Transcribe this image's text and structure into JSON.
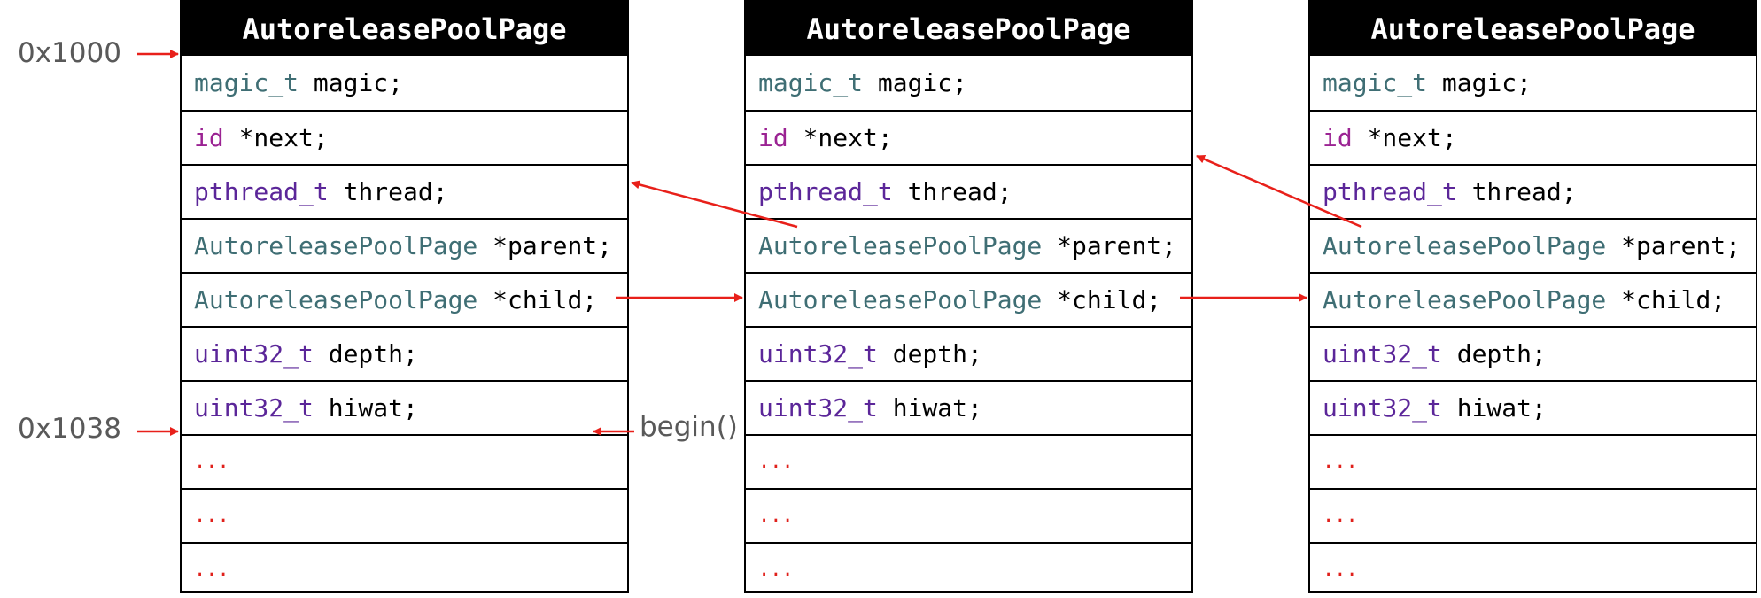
{
  "pages": [
    {
      "title": "AutoreleasePoolPage",
      "rows": [
        [
          {
            "text": "magic_t",
            "style": "teal"
          },
          {
            "text": " magic;",
            "style": "plain"
          }
        ],
        [
          {
            "text": "id",
            "style": "magenta"
          },
          {
            "text": " *next;",
            "style": "plain"
          }
        ],
        [
          {
            "text": "pthread_t",
            "style": "purple"
          },
          {
            "text": " thread;",
            "style": "plain"
          }
        ],
        [
          {
            "text": "AutoreleasePoolPage",
            "style": "teal"
          },
          {
            "text": " *parent;",
            "style": "plain"
          }
        ],
        [
          {
            "text": "AutoreleasePoolPage",
            "style": "teal"
          },
          {
            "text": " *child;",
            "style": "plain"
          }
        ],
        [
          {
            "text": "uint32_t",
            "style": "purple"
          },
          {
            "text": " depth;",
            "style": "plain"
          }
        ],
        [
          {
            "text": "uint32_t",
            "style": "purple"
          },
          {
            "text": " hiwat;",
            "style": "plain"
          }
        ],
        [
          {
            "text": "...",
            "style": "red"
          }
        ],
        [
          {
            "text": "...",
            "style": "red"
          }
        ],
        [
          {
            "text": "...",
            "style": "red"
          }
        ]
      ]
    },
    {
      "title": "AutoreleasePoolPage",
      "rows": [
        [
          {
            "text": "magic_t",
            "style": "teal"
          },
          {
            "text": " magic;",
            "style": "plain"
          }
        ],
        [
          {
            "text": "id",
            "style": "magenta"
          },
          {
            "text": " *next;",
            "style": "plain"
          }
        ],
        [
          {
            "text": "pthread_t",
            "style": "purple"
          },
          {
            "text": " thread;",
            "style": "plain"
          }
        ],
        [
          {
            "text": "AutoreleasePoolPage",
            "style": "teal"
          },
          {
            "text": " *parent;",
            "style": "plain"
          }
        ],
        [
          {
            "text": "AutoreleasePoolPage",
            "style": "teal"
          },
          {
            "text": " *child;",
            "style": "plain"
          }
        ],
        [
          {
            "text": "uint32_t",
            "style": "purple"
          },
          {
            "text": " depth;",
            "style": "plain"
          }
        ],
        [
          {
            "text": "uint32_t",
            "style": "purple"
          },
          {
            "text": " hiwat;",
            "style": "plain"
          }
        ],
        [
          {
            "text": "...",
            "style": "red"
          }
        ],
        [
          {
            "text": "...",
            "style": "red"
          }
        ],
        [
          {
            "text": "...",
            "style": "red"
          }
        ]
      ]
    },
    {
      "title": "AutoreleasePoolPage",
      "rows": [
        [
          {
            "text": "magic_t",
            "style": "teal"
          },
          {
            "text": " magic;",
            "style": "plain"
          }
        ],
        [
          {
            "text": "id",
            "style": "magenta"
          },
          {
            "text": " *next;",
            "style": "plain"
          }
        ],
        [
          {
            "text": "pthread_t",
            "style": "purple"
          },
          {
            "text": " thread;",
            "style": "plain"
          }
        ],
        [
          {
            "text": "AutoreleasePoolPage",
            "style": "teal"
          },
          {
            "text": " *parent;",
            "style": "plain"
          }
        ],
        [
          {
            "text": "AutoreleasePoolPage",
            "style": "teal"
          },
          {
            "text": " *child;",
            "style": "plain"
          }
        ],
        [
          {
            "text": "uint32_t",
            "style": "purple"
          },
          {
            "text": " depth;",
            "style": "plain"
          }
        ],
        [
          {
            "text": "uint32_t",
            "style": "purple"
          },
          {
            "text": " hiwat;",
            "style": "plain"
          }
        ],
        [
          {
            "text": "...",
            "style": "red"
          }
        ],
        [
          {
            "text": "...",
            "style": "red"
          }
        ],
        [
          {
            "text": "...",
            "style": "red"
          }
        ]
      ]
    }
  ],
  "labels": {
    "addr_start": "0x1000",
    "addr_begin": "0x1038",
    "begin": "begin()"
  },
  "colors": {
    "arrow": "#e8201a",
    "type_teal": "#3f6e74",
    "type_purple": "#5b2699",
    "keyword_magenta": "#9b2393",
    "ellipsis_red": "#e0201b",
    "label_gray": "#595959"
  }
}
